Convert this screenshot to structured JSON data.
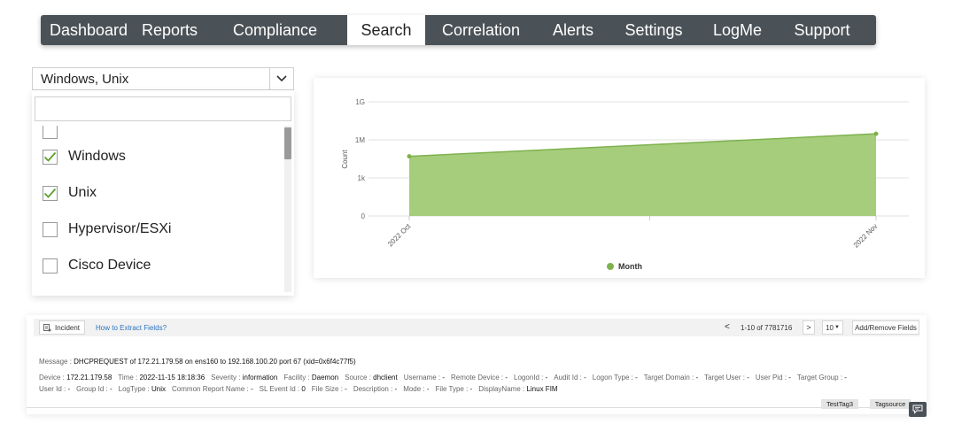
{
  "nav": {
    "items": [
      {
        "label": "Dashboard",
        "active": false
      },
      {
        "label": "Reports",
        "active": false
      },
      {
        "label": "Compliance",
        "active": false
      },
      {
        "label": "Search",
        "active": true
      },
      {
        "label": "Correlation",
        "active": false
      },
      {
        "label": "Alerts",
        "active": false
      },
      {
        "label": "Settings",
        "active": false
      },
      {
        "label": "LogMe",
        "active": false
      },
      {
        "label": "Support",
        "active": false
      }
    ]
  },
  "filter": {
    "selected_value": "Windows, Unix",
    "search_placeholder": "",
    "options": [
      {
        "label": "Windows",
        "checked": true
      },
      {
        "label": "Unix",
        "checked": true
      },
      {
        "label": "Hypervisor/ESXi",
        "checked": false
      },
      {
        "label": "Cisco Device",
        "checked": false
      }
    ]
  },
  "chart_data": {
    "type": "area",
    "x": [
      "2022 Oct",
      "2022 Nov"
    ],
    "series": [
      {
        "name": "Month",
        "values": [
          50000,
          3000000
        ],
        "color": "#9bc66e"
      }
    ],
    "ylabel": "Count",
    "xlabel": "",
    "yscale": "log",
    "yticks": [
      "0",
      "1k",
      "1M",
      "1G"
    ],
    "grid": true,
    "legend": "bottom"
  },
  "log": {
    "incident_label": "Incident",
    "extract_link": "How to Extract Fields?",
    "pager": {
      "prev": "<",
      "range": "1-10 of 7781716",
      "next": ">",
      "page_size": "10"
    },
    "add_fields_label": "Add/Remove Fields",
    "message_key": "Message",
    "message_value": "DHCPREQUEST of 172.21.179.58 on ens160 to 192.168.100.20 port 67 (xid=0x6f4c77f5)",
    "fields_row1": [
      {
        "k": "Device",
        "v": "172.21.179.58"
      },
      {
        "k": "Time",
        "v": "2022-11-15 18:18:36"
      },
      {
        "k": "Severity",
        "v": "information"
      },
      {
        "k": "Facility",
        "v": "Daemon"
      },
      {
        "k": "Source",
        "v": "dhclient"
      },
      {
        "k": "Username",
        "v": "-"
      },
      {
        "k": "Remote Device",
        "v": "-"
      },
      {
        "k": "LogonId",
        "v": "-"
      },
      {
        "k": "Audit Id",
        "v": "-"
      },
      {
        "k": "Logon Type",
        "v": "-"
      },
      {
        "k": "Target Domain",
        "v": "-"
      },
      {
        "k": "Target User",
        "v": "-"
      },
      {
        "k": "User Pid",
        "v": "-"
      },
      {
        "k": "Target Group",
        "v": "-"
      }
    ],
    "fields_row2": [
      {
        "k": "User Id",
        "v": "-"
      },
      {
        "k": "Group Id",
        "v": "-"
      },
      {
        "k": "LogType",
        "v": "Unix"
      },
      {
        "k": "Common Report Name",
        "v": "-"
      },
      {
        "k": "SL Event Id",
        "v": "0"
      },
      {
        "k": "File Size",
        "v": "-"
      },
      {
        "k": "Description",
        "v": "-"
      },
      {
        "k": "Mode",
        "v": "-"
      },
      {
        "k": "File Type",
        "v": "-"
      },
      {
        "k": "DisplayName",
        "v": "Linux FIM"
      }
    ],
    "tags": [
      "TestTag3",
      "Tagsource"
    ]
  },
  "colors": {
    "nav_bg": "#4b5257",
    "area_fill": "#a5cd7c",
    "area_line": "#7fb24e",
    "checkmark": "#5aa02c",
    "link": "#2a73c0"
  }
}
